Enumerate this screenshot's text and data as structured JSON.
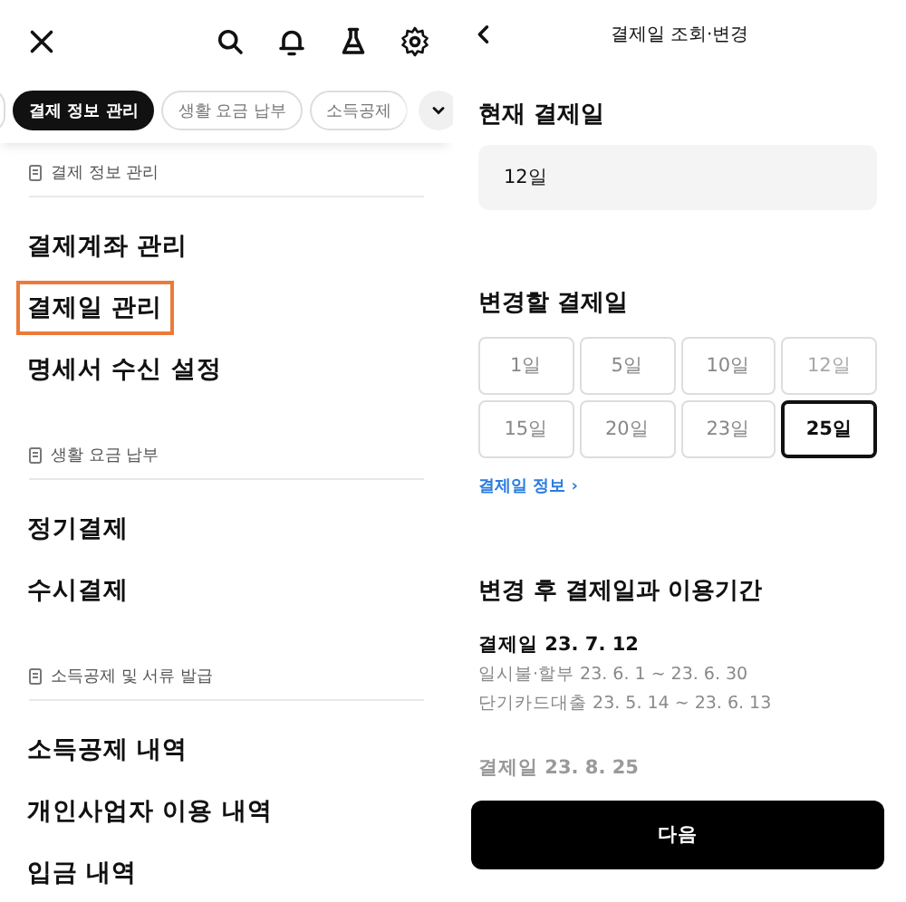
{
  "menu_panel": {
    "chips": [
      {
        "label": "결제 정보 관리",
        "selected": true
      },
      {
        "label": "생활 요금 납부",
        "selected": false
      },
      {
        "label": "소득공제",
        "selected": false
      }
    ],
    "sections": [
      {
        "title": "결제 정보 관리",
        "items": [
          {
            "label": "결제계좌 관리",
            "highlighted": false
          },
          {
            "label": "결제일 관리",
            "highlighted": true
          },
          {
            "label": "명세서 수신 설정",
            "highlighted": false
          }
        ]
      },
      {
        "title": "생활 요금 납부",
        "items": [
          {
            "label": "정기결제",
            "highlighted": false
          },
          {
            "label": "수시결제",
            "highlighted": false
          }
        ]
      },
      {
        "title": "소득공제 및 서류 발급",
        "items": [
          {
            "label": "소득공제 내역",
            "highlighted": false
          },
          {
            "label": "개인사업자 이용 내역",
            "highlighted": false
          },
          {
            "label": "입금 내역",
            "highlighted": false
          }
        ]
      }
    ]
  },
  "detail_panel": {
    "title": "결제일 조회·변경",
    "current_label": "현재 결제일",
    "current_value": "12일",
    "change_label": "변경할 결제일",
    "days": [
      {
        "label": "1일",
        "selected": false,
        "disabled": false
      },
      {
        "label": "5일",
        "selected": false,
        "disabled": false
      },
      {
        "label": "10일",
        "selected": false,
        "disabled": false
      },
      {
        "label": "12일",
        "selected": false,
        "disabled": true
      },
      {
        "label": "15일",
        "selected": false,
        "disabled": false
      },
      {
        "label": "20일",
        "selected": false,
        "disabled": false
      },
      {
        "label": "23일",
        "selected": false,
        "disabled": false
      },
      {
        "label": "25일",
        "selected": true,
        "disabled": false
      }
    ],
    "info_link": "결제일 정보",
    "info_link_chevron": "›",
    "period_title": "변경 후 결제일과 이용기간",
    "periods": [
      {
        "date": "결제일 23. 7. 12",
        "lines": [
          "일시불·할부 23. 6. 1 ~ 23. 6. 30",
          "단기카드대출 23. 5. 14 ~ 23. 6. 13"
        ],
        "faded": false
      },
      {
        "date": "결제일 23. 8. 25",
        "faded": true
      }
    ],
    "next_button": "다음"
  }
}
